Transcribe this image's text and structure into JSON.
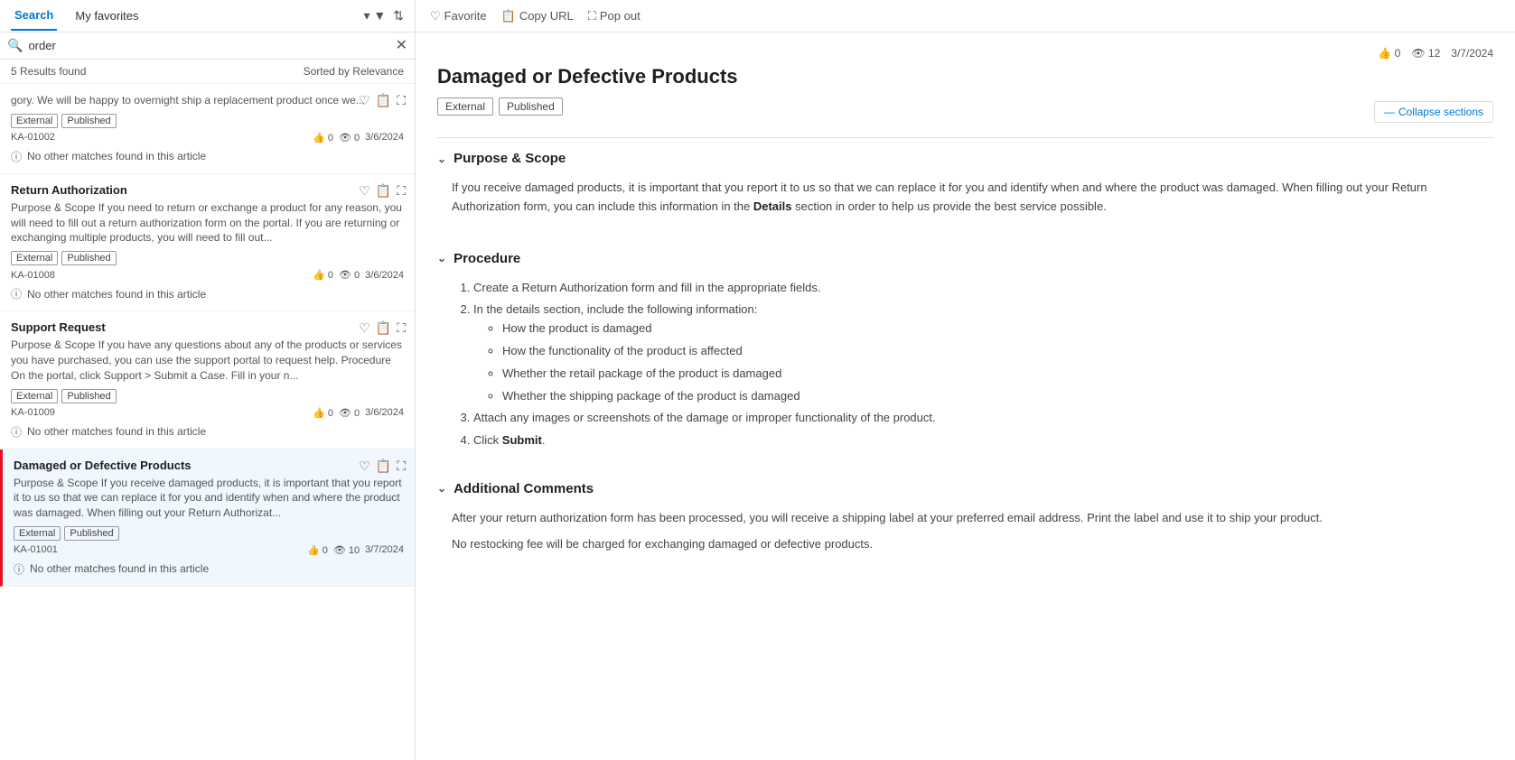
{
  "tabs": {
    "search_label": "Search",
    "favorites_label": "My favorites",
    "active": "search"
  },
  "toolbar": {
    "filter_icon": "▾",
    "sort_icon": "⇅",
    "favorite_label": "Favorite",
    "copy_url_label": "Copy URL",
    "pop_out_label": "Pop out"
  },
  "search": {
    "placeholder": "order",
    "value": "order",
    "results_count": "5 Results found",
    "sort_label": "Sorted by Relevance"
  },
  "results": [
    {
      "id": "r1",
      "title": null,
      "excerpt": "gory. We will be happy to overnight ship a replacement product once we...",
      "badges": [
        "External",
        "Published"
      ],
      "ka": "KA-01002",
      "likes": "0",
      "views": "0",
      "date": "3/6/2024",
      "no_match": "No other matches found in this article",
      "selected": false
    },
    {
      "id": "r2",
      "title": "Return Authorization",
      "excerpt": "Purpose & Scope If you need to return or exchange a product for any reason, you will need to fill out a return authorization form on the portal. If you are returning or exchanging multiple products, you will need to fill out...",
      "badges": [
        "External",
        "Published"
      ],
      "ka": "KA-01008",
      "likes": "0",
      "views": "0",
      "date": "3/6/2024",
      "no_match": "No other matches found in this article",
      "selected": false
    },
    {
      "id": "r3",
      "title": "Support Request",
      "excerpt": "Purpose & Scope If you have any questions about any of the products or services you have purchased, you can use the support portal to request help. Procedure On the portal, click Support > Submit a Case. Fill in your n...",
      "badges": [
        "External",
        "Published"
      ],
      "ka": "KA-01009",
      "likes": "0",
      "views": "0",
      "date": "3/6/2024",
      "no_match": "No other matches found in this article",
      "selected": false
    },
    {
      "id": "r4",
      "title": "Damaged or Defective Products",
      "excerpt": "Purpose & Scope If you receive damaged products, it is important that you report it to us so that we can replace it for you and identify when and where the product was damaged. When filling out your Return Authorizat...",
      "badges": [
        "External",
        "Published"
      ],
      "ka": "KA-01001",
      "likes": "0",
      "views": "10",
      "date": "3/7/2024",
      "no_match": "No other matches found in this article",
      "selected": true
    }
  ],
  "article": {
    "title": "Damaged or Defective Products",
    "badges": [
      "External",
      "Published"
    ],
    "likes": "0",
    "views": "12",
    "date": "3/7/2024",
    "collapse_label": "Collapse sections",
    "sections": [
      {
        "id": "s1",
        "heading": "Purpose & Scope",
        "expanded": true,
        "body_paragraphs": [
          "If you receive damaged products, it is important that you report it to us so that we can replace it for you and identify when and where the product was damaged. When filling out your Return Authorization form, you can include this information in the Details section in order to help us provide the best service possible."
        ],
        "bold_word": "Details"
      },
      {
        "id": "s2",
        "heading": "Procedure",
        "expanded": true,
        "ordered_items": [
          "Create a Return Authorization form and fill in the appropriate fields.",
          "In the details section, include the following information:",
          "Attach any images or screenshots of the damage or improper functionality of the product.",
          "Click Submit."
        ],
        "sub_items": [
          "How the product is damaged",
          "How the functionality of the product is affected",
          "Whether the retail package of the product is damaged",
          "Whether the shipping package of the product is damaged"
        ],
        "bold_in_last": "Submit"
      },
      {
        "id": "s3",
        "heading": "Additional Comments",
        "expanded": true,
        "body_paragraphs": [
          "After your return authorization form has been processed, you will receive a shipping label at your preferred email address. Print the label and use it to ship your product.",
          "No restocking fee will be charged for exchanging damaged or defective products."
        ]
      }
    ]
  }
}
